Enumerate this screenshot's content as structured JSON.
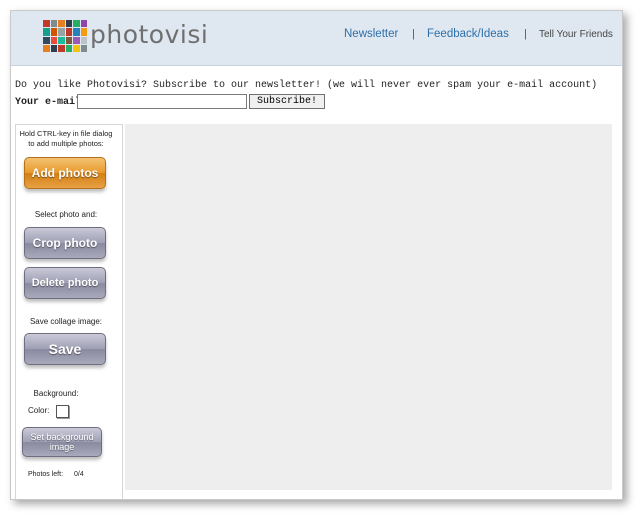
{
  "header": {
    "logo_text": "photovisi",
    "nav": {
      "newsletter": "Newsletter",
      "feedback": "Feedback/Ideas",
      "tell_friends": "Tell Your Friends",
      "separator": "|"
    }
  },
  "newsletter_bar": {
    "prompt": "Do you like Photovisi? Subscribe to our newsletter! (we will never ever spam your e-mail account)",
    "email_label": "Your e-mail:",
    "email_value": "",
    "subscribe_label": "Subscribe!"
  },
  "sidebar": {
    "hint": "Hold CTRL-key in file dialog to add multiple photos:",
    "add_photos_label": "Add photos",
    "select_label": "Select photo and:",
    "crop_label": "Crop photo",
    "delete_label": "Delete photo",
    "save_heading": "Save collage image:",
    "save_label": "Save",
    "background_label": "Background:",
    "color_label": "Color:",
    "set_bg_label": "Set background image",
    "photos_left_label": "Photos left:",
    "photos_left_value": "0/4"
  },
  "colors": {
    "header_bg": "#dfe8f1",
    "link": "#2e6fa9",
    "add_button": "#e89a2b",
    "gray_button": "#9f9fb4",
    "canvas_bg": "#eeeeee",
    "background_color_swatch": "#ffffff"
  },
  "icons": {
    "logo": "photo-mosaic-logo",
    "color_picker": "color-swatch"
  }
}
